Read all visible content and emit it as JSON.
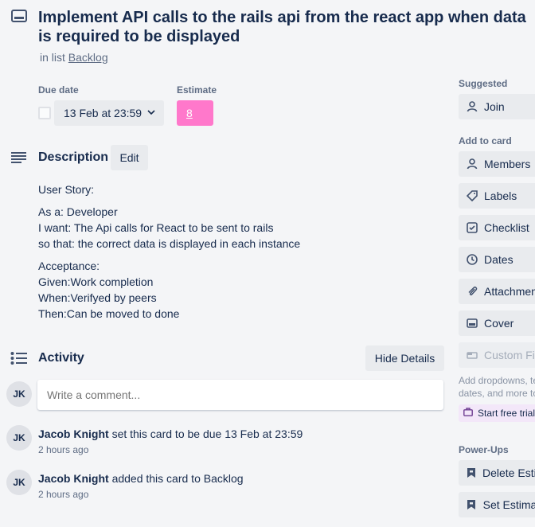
{
  "card": {
    "title": "Implement API calls to the rails api from the react app when data is required to be displayed",
    "in_list_prefix": "in list",
    "list_name": "Backlog"
  },
  "fields": {
    "due_date_label": "Due date",
    "due_date_value": "13 Feb at 23:59",
    "estimate_label": "Estimate",
    "estimate_value": "8",
    "estimate_color": "#ff78cb"
  },
  "description": {
    "title": "Description",
    "edit_label": "Edit",
    "lines": [
      "User Story:",
      "As a: Developer",
      "I want: The Api calls for React to be sent to rails",
      "so that: the correct data is displayed in each instance",
      "Acceptance:",
      "Given:Work completion",
      "When:Verifyed by peers",
      "Then:Can be moved to done"
    ]
  },
  "activity": {
    "title": "Activity",
    "hide_details_label": "Hide Details",
    "comment_placeholder": "Write a comment...",
    "avatar_initials": "JK",
    "items": [
      {
        "user": "Jacob Knight",
        "text": "set this card to be due 13 Feb at 23:59",
        "time": "2 hours ago"
      },
      {
        "user": "Jacob Knight",
        "text": "added this card to Backlog",
        "time": "2 hours ago"
      }
    ]
  },
  "sidebar": {
    "suggested_label": "Suggested",
    "join_label": "Join",
    "add_to_card_label": "Add to card",
    "members_label": "Members",
    "labels_label": "Labels",
    "checklist_label": "Checklist",
    "dates_label": "Dates",
    "attachment_label": "Attachment",
    "cover_label": "Cover",
    "custom_fields_label": "Custom Fields",
    "note_line1": "Add dropdowns, text fields,",
    "note_line2": "dates, and more to your cards.",
    "trial_label": "Start free trial",
    "powerups_label": "Power-Ups",
    "delete_estimate_label": "Delete Estimate",
    "set_estimate_label": "Set Estimate"
  }
}
